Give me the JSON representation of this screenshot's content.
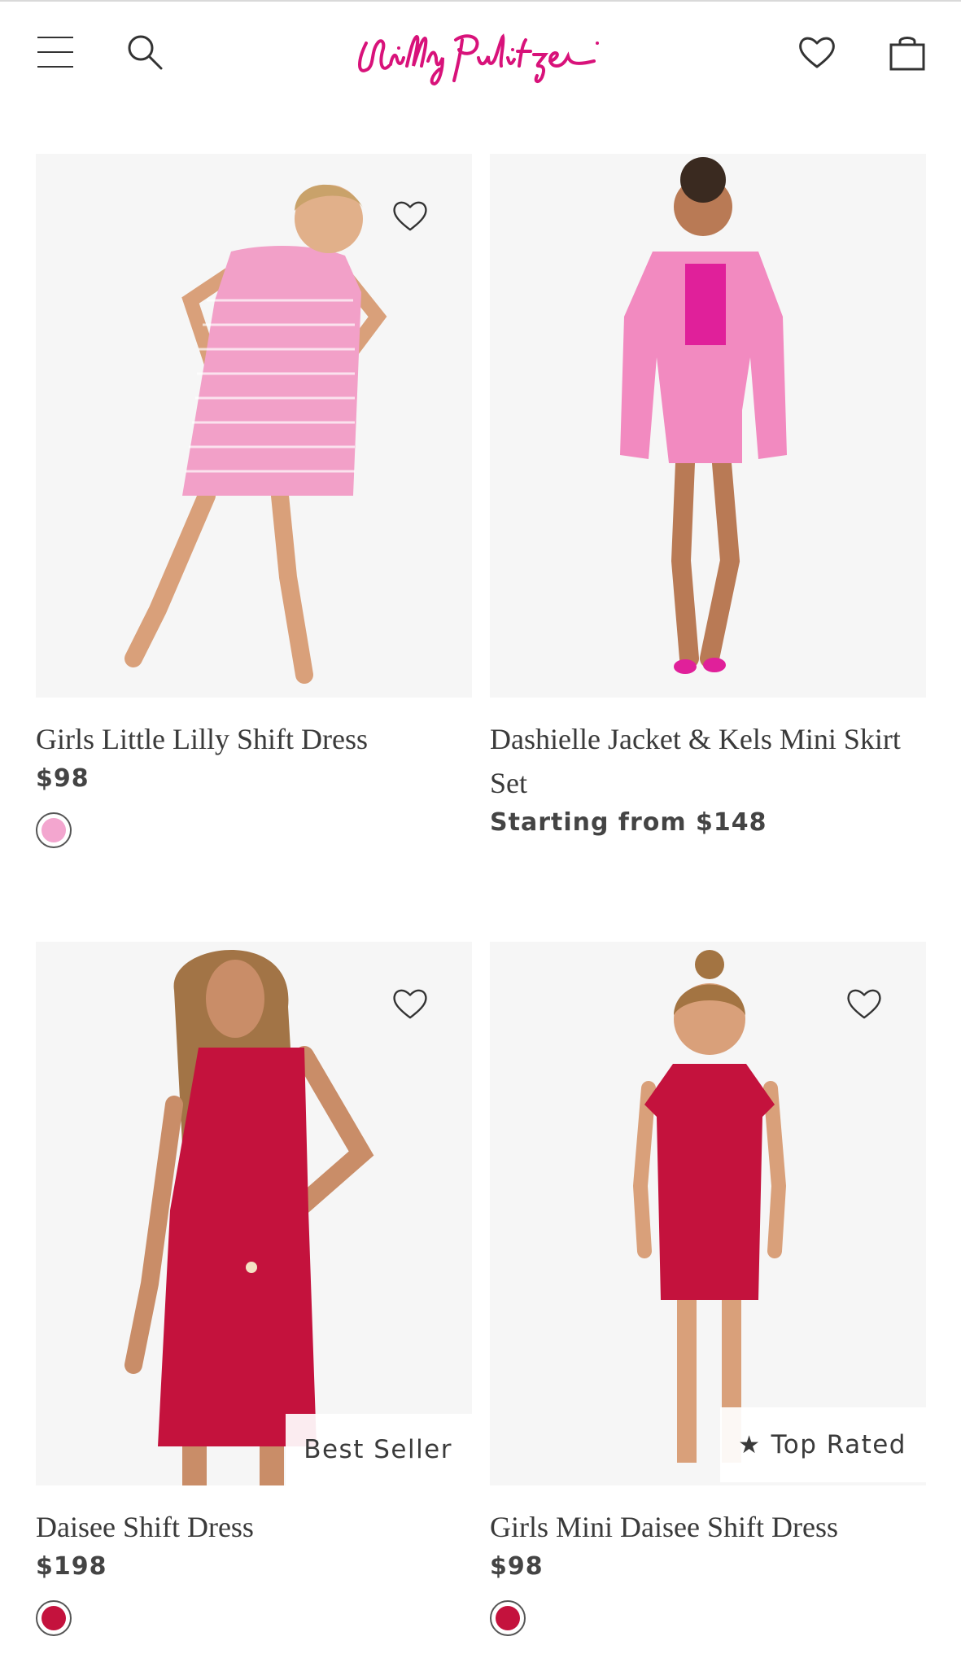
{
  "header": {
    "logo_text": "Lilly Pulitzer",
    "icons": [
      "menu-icon",
      "search-icon",
      "heart-icon",
      "shopping-bag-icon"
    ]
  },
  "colors": {
    "brand_pink": "#d8127a",
    "swatch_pink": "#f3a6cf",
    "swatch_red": "#c4123d"
  },
  "products": [
    {
      "title": "Girls Little Lilly Shift Dress",
      "price": "$98",
      "swatch_color": "#f3a6cf",
      "wishlist_icon": "heart-outline-icon"
    },
    {
      "title": "Dashielle Jacket & Kels Mini Skirt Set",
      "price": "Starting from $148"
    },
    {
      "title": "Daisee Shift Dress",
      "price": "$198",
      "badge": "Best Seller",
      "swatch_color": "#c4123d",
      "wishlist_icon": "heart-outline-icon"
    },
    {
      "title": "Girls Mini Daisee Shift Dress",
      "price": "$98",
      "badge": "Top Rated",
      "badge_icon": "star-icon",
      "swatch_color": "#c4123d",
      "wishlist_icon": "heart-outline-icon"
    }
  ]
}
